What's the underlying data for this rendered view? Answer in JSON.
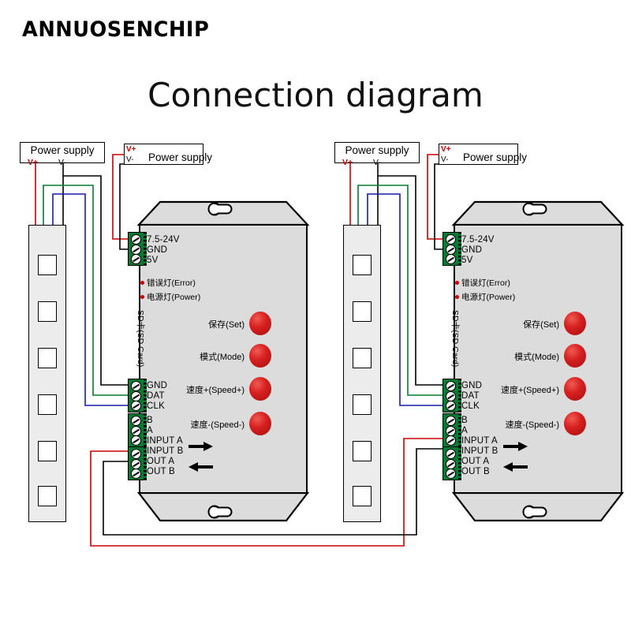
{
  "brand": "ANNUOSENCHIP",
  "title": "Connection diagram",
  "colors": {
    "wire_positive": "#cc0000",
    "wire_ground": "#000000",
    "wire_data": "#0a7a32",
    "wire_clock": "#1a1aaa",
    "terminal_green": "#0a7a32",
    "button_red": "#cc1111",
    "controller_body": "#dcdcdc",
    "led_strip": "#ececec"
  },
  "power_supply_a": {
    "title": "Power supply",
    "v_plus": "V+",
    "v_minus": "V-"
  },
  "power_supply_b": {
    "title": "Power supply",
    "v_plus": "V+",
    "v_minus": "V-"
  },
  "controller": {
    "power_terminal": {
      "pins": [
        "7.5-24V",
        "GND",
        "5V"
      ]
    },
    "indicators": [
      {
        "label": "错误灯(Error)"
      },
      {
        "label": "电源灯(Power)"
      }
    ],
    "sd_card_label": "SD卡(SD Card)",
    "buttons": [
      {
        "label": "保存(Set)"
      },
      {
        "label": "模式(Mode)"
      },
      {
        "label": "速度+(Speed+)"
      },
      {
        "label": "速度-(Speed-)"
      }
    ],
    "signal_terminals": [
      {
        "pins": [
          "GND",
          "DAT",
          "CLK"
        ]
      },
      {
        "pins": [
          "B",
          "A",
          "INPUT  A"
        ]
      },
      {
        "pins": [
          "INPUT  B",
          "OUT  A",
          "OUT  B"
        ]
      }
    ],
    "arrows": [
      {
        "name": "input-arrow",
        "direction": "right"
      },
      {
        "name": "output-arrow",
        "direction": "left"
      }
    ]
  },
  "led_strip": {
    "pixel_count": 6
  },
  "units": [
    {
      "name": "unit-left"
    },
    {
      "name": "unit-right"
    }
  ]
}
